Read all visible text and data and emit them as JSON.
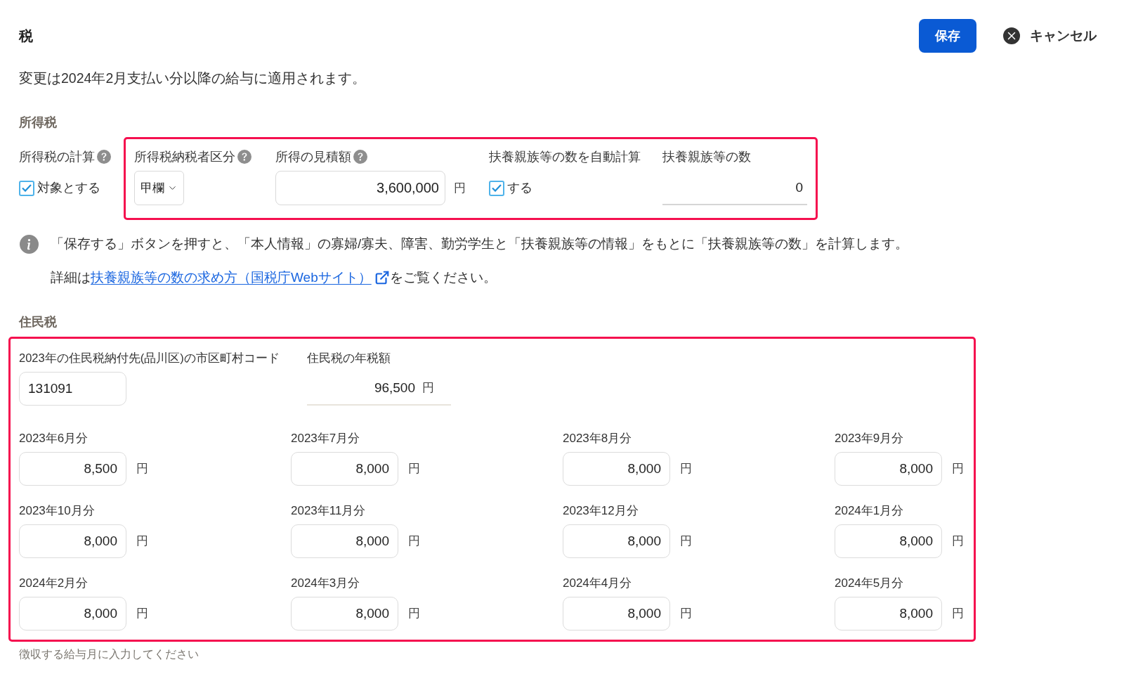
{
  "header": {
    "title": "税",
    "actions": [
      {
        "kind": "primary",
        "label": "保存"
      },
      {
        "kind": "cancel",
        "label": "キャンセル"
      }
    ]
  },
  "notice": "変更は2024年2月支払い分以降の給与に適用されます。",
  "income_tax": {
    "heading": "所得税",
    "calculation": {
      "label": "所得税の計算",
      "help": true,
      "option": "対象とする",
      "checked": true
    },
    "highlighted": true,
    "fields": [
      {
        "kind": "select",
        "label": "所得税納税者区分",
        "help": true,
        "value": "甲欄"
      },
      {
        "kind": "amount",
        "label": "所得の見積額",
        "help": true,
        "value": "3,600,000",
        "unit": "円"
      },
      {
        "kind": "checkbox",
        "label": "扶養親族等の数を自動計算",
        "help": false,
        "option": "する",
        "checked": true
      },
      {
        "kind": "readonly",
        "label": "扶養親族等の数",
        "help": false,
        "value": "0"
      }
    ]
  },
  "info": {
    "text": "「保存する」ボタンを押すと、「本人情報」の寡婦/寡夫、障害、勤労学生と「扶養親族等の情報」をもとに「扶養親族等の数」を計算します。",
    "detail_before": "詳細は",
    "link": "扶養親族等の数の求め方（国税庁Webサイト）",
    "detail_after": "をご覧ください。"
  },
  "resident_tax": {
    "heading": "住民税",
    "highlighted": true,
    "code": {
      "label": "2023年の住民税納付先(品川区)の市区町村コード",
      "value": "131091"
    },
    "annual": {
      "label": "住民税の年税額",
      "value": "96,500",
      "unit": "円"
    },
    "months": [
      {
        "label": "2023年6月分",
        "value": "8,500",
        "unit": "円"
      },
      {
        "label": "2023年7月分",
        "value": "8,000",
        "unit": "円"
      },
      {
        "label": "2023年8月分",
        "value": "8,000",
        "unit": "円"
      },
      {
        "label": "2023年9月分",
        "value": "8,000",
        "unit": "円"
      },
      {
        "label": "2023年10月分",
        "value": "8,000",
        "unit": "円"
      },
      {
        "label": "2023年11月分",
        "value": "8,000",
        "unit": "円"
      },
      {
        "label": "2023年12月分",
        "value": "8,000",
        "unit": "円"
      },
      {
        "label": "2024年1月分",
        "value": "8,000",
        "unit": "円"
      },
      {
        "label": "2024年2月分",
        "value": "8,000",
        "unit": "円"
      },
      {
        "label": "2024年3月分",
        "value": "8,000",
        "unit": "円"
      },
      {
        "label": "2024年4月分",
        "value": "8,000",
        "unit": "円"
      },
      {
        "label": "2024年5月分",
        "value": "8,000",
        "unit": "円"
      }
    ],
    "hint": "徴収する給与月に入力してください"
  }
}
